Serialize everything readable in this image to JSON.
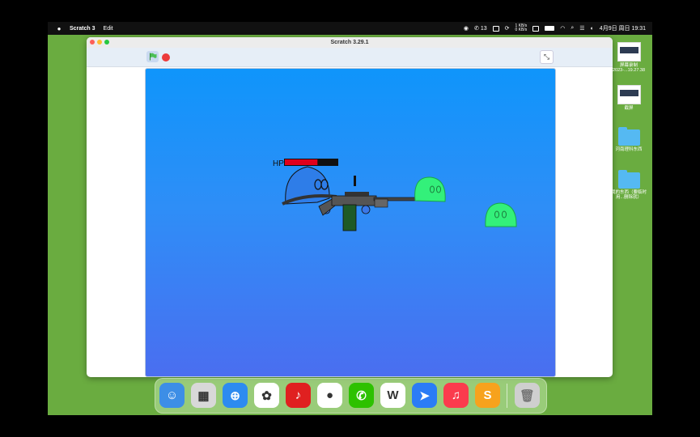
{
  "menubar": {
    "app_name": "Scratch 3",
    "menu_edit": "Edit",
    "wechat_count": "13",
    "net_up": "1 KB/s",
    "net_down": "0 KB/s",
    "datetime": "4月9日 周日 19:31"
  },
  "window": {
    "title": "Scratch 3.29.1"
  },
  "game": {
    "hp_label": "HP",
    "hp_fraction": 0.62,
    "colors": {
      "sky_top": "#0f95fb",
      "sky_bottom": "#4a6ef0",
      "player": "#2e7de8",
      "enemy_slime": "#33f07a",
      "hp_bar": "#e0001b"
    }
  },
  "desktop_icons": [
    {
      "label": "屏幕录制 2023-...19.27.38",
      "icon": "screenshot-thumb"
    },
    {
      "label": "截屏",
      "icon": "screenshot-thumb"
    },
    {
      "label": "河南理科东西",
      "icon": "folder-icon"
    },
    {
      "label": "我的东西（要临时用...删除就）",
      "icon": "folder-icon"
    }
  ],
  "dock": [
    {
      "name": "finder-icon",
      "bg": "#3d8ee6",
      "glyph": "☺"
    },
    {
      "name": "launchpad-icon",
      "bg": "#d8d8d8",
      "glyph": "▦"
    },
    {
      "name": "safari-icon",
      "bg": "#2d8bf0",
      "glyph": "⊕"
    },
    {
      "name": "photos-icon",
      "bg": "#ffffff",
      "glyph": "✿"
    },
    {
      "name": "netease-music-icon",
      "bg": "#e02020",
      "glyph": "♪"
    },
    {
      "name": "qq-icon",
      "bg": "#ffffff",
      "glyph": "●"
    },
    {
      "name": "wechat-icon",
      "bg": "#2dc100",
      "glyph": "✆"
    },
    {
      "name": "wps-icon",
      "bg": "#ffffff",
      "glyph": "W"
    },
    {
      "name": "feishu-icon",
      "bg": "#2b7cf6",
      "glyph": "➤"
    },
    {
      "name": "music-icon",
      "bg": "#fb3b4d",
      "glyph": "♫"
    },
    {
      "name": "scratch-icon",
      "bg": "#f7a21d",
      "glyph": "S"
    }
  ]
}
